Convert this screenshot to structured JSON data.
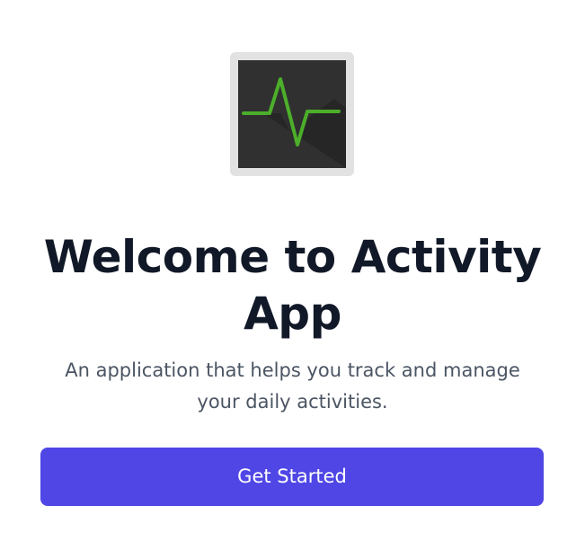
{
  "app_icon": {
    "icon": "activity-monitor-icon",
    "frame_color": "#e2e2e2",
    "screen_color": "#303030",
    "line_color": "#4caf2a"
  },
  "welcome": {
    "title_line1": "Welcome to Activity",
    "title_line2": "App",
    "description_line1": "An application that helps you track and manage",
    "description_line2": "your daily activities."
  },
  "actions": {
    "get_started_label": "Get Started"
  },
  "colors": {
    "primary": "#4f46e5",
    "title_text": "#111827",
    "body_text": "#4b5563"
  }
}
